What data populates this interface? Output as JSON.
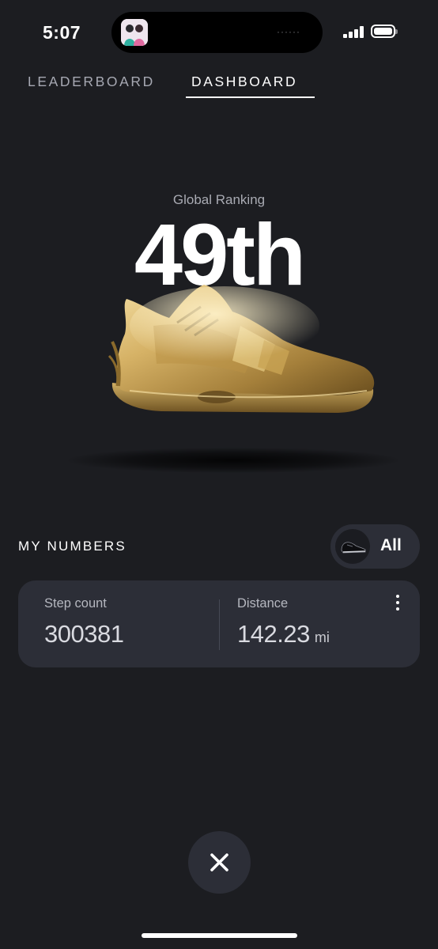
{
  "status_bar": {
    "time": "5:07",
    "island_indicator": "······"
  },
  "tabs": [
    {
      "label": "LEADERBOARD",
      "active": false
    },
    {
      "label": "DASHBOARD",
      "active": true
    }
  ],
  "ranking": {
    "caption": "Global Ranking",
    "value": "49th"
  },
  "hero_image": {
    "icon": "gold-sneaker",
    "accent_color": "#d4b064"
  },
  "my_numbers": {
    "title": "MY NUMBERS",
    "filter": {
      "label": "All",
      "icon": "sneaker-thumbnail"
    },
    "stats": [
      {
        "label": "Step count",
        "value": "300381",
        "unit": ""
      },
      {
        "label": "Distance",
        "value": "142.23",
        "unit": "mi"
      }
    ],
    "more_icon": "more-vertical"
  },
  "close_icon": "close",
  "colors": {
    "background": "#1c1d21",
    "card": "#2c2e37",
    "text_primary": "#ffffff",
    "text_muted": "#a9abb3"
  }
}
